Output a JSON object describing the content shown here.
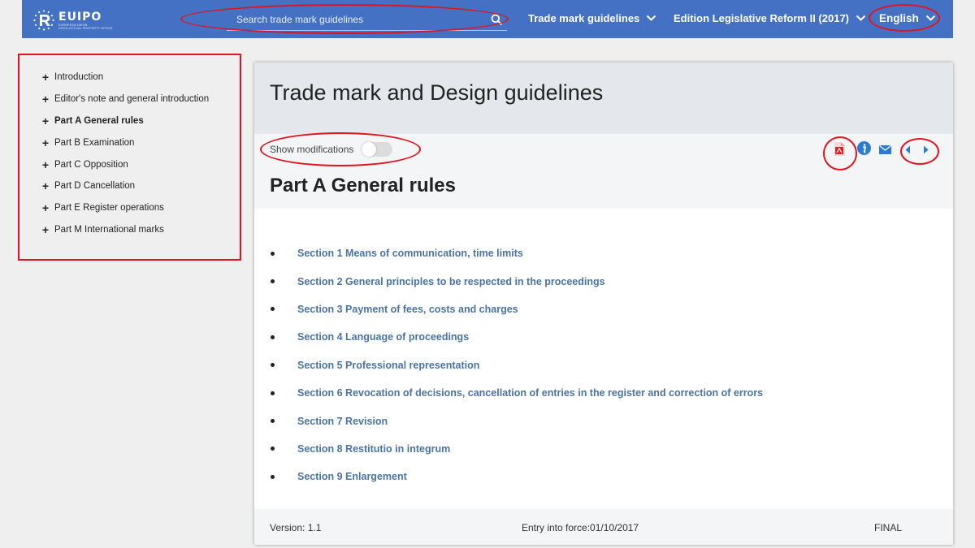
{
  "header": {
    "logo_title": "EUIPO",
    "logo_sub_1": "EUROPEAN UNION",
    "logo_sub_2": "INTELLECTUAL PROPERTY OFFICE",
    "search_placeholder": "Search trade mark guidelines",
    "nav_guidelines": "Trade mark guidelines",
    "nav_edition": "Edition Legislative Reform II (2017)",
    "nav_language": "English"
  },
  "sidebar": {
    "items": [
      {
        "label": "Introduction"
      },
      {
        "label": "Editor's note and general introduction"
      },
      {
        "label": "Part A General rules"
      },
      {
        "label": "Part B Examination"
      },
      {
        "label": "Part C Opposition"
      },
      {
        "label": "Part D Cancellation"
      },
      {
        "label": "Part E Register operations"
      },
      {
        "label": "Part M International marks"
      }
    ],
    "active_index": 2
  },
  "main": {
    "title": "Trade mark and Design guidelines",
    "toggle_label": "Show modifications",
    "toggle_on": false,
    "part_title": "Part A General rules",
    "sections": [
      {
        "label": "Section 1 Means of communication, time limits"
      },
      {
        "label": "Section 2 General principles to be respected in the proceedings"
      },
      {
        "label": "Section 3 Payment of fees, costs and charges"
      },
      {
        "label": "Section 4 Language of proceedings"
      },
      {
        "label": "Section 5 Professional representation"
      },
      {
        "label": "Section 6 Revocation of decisions, cancellation of entries in the register and correction of errors"
      },
      {
        "label": "Section 7 Revision"
      },
      {
        "label": "Section 8 Restitutio in integrum"
      },
      {
        "label": "Section 9 Enlargement"
      }
    ],
    "footer": {
      "version": "Version: 1.1",
      "entry_into_force": "Entry into force:01/10/2017",
      "status": "FINAL"
    }
  },
  "colors": {
    "header_bg": "#4471c4",
    "link": "#4a73a6",
    "annotation_red": "#e0141f",
    "pdf_red": "#d9232d",
    "info_blue": "#2a7bd5"
  },
  "icons": [
    "euipo-logo-icon",
    "search-icon",
    "chevron-down-icon",
    "plus-icon",
    "pdf-icon",
    "info-icon",
    "mail-icon",
    "arrow-left-icon",
    "arrow-right-icon"
  ]
}
